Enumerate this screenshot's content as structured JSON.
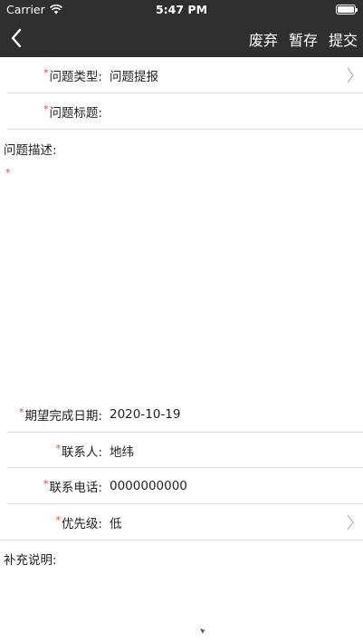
{
  "status_bar": {
    "carrier": "Carrier",
    "time": "5:47 PM"
  },
  "nav": {
    "back_icon": "chevron-left-icon",
    "discard_label": "废弃",
    "save_draft_label": "暂存",
    "submit_label": "提交"
  },
  "form": {
    "required_mark": "*",
    "problem_type": {
      "label": "问题类型:",
      "value": "问题提报"
    },
    "problem_title": {
      "label": "问题标题:",
      "value": ""
    },
    "problem_description": {
      "label": "问题描述:",
      "value": ""
    },
    "expected_date": {
      "label": "期望完成日期:",
      "value": "2020-10-19"
    },
    "contact": {
      "label": "联系人:",
      "value": "地纬"
    },
    "contact_phone": {
      "label": "联系电话:",
      "value": "0000000000"
    },
    "priority": {
      "label": "优先级:",
      "value": "低"
    },
    "supplement": {
      "label": "补充说明:",
      "value": ""
    }
  },
  "colors": {
    "nav_background": "#2f2f2f",
    "required": "#e0463a",
    "separator": "#dcdcdc"
  }
}
